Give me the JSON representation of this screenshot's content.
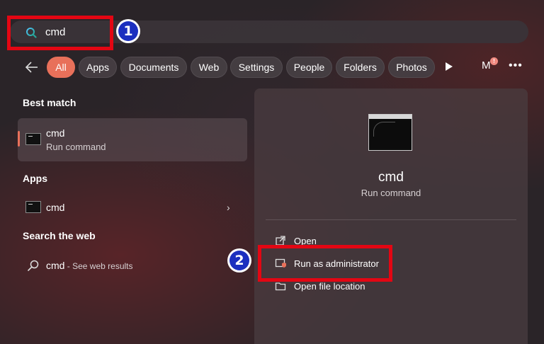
{
  "search": {
    "query": "cmd"
  },
  "annotations": {
    "badge1": "1",
    "badge2": "2"
  },
  "filters": [
    "All",
    "Apps",
    "Documents",
    "Web",
    "Settings",
    "People",
    "Folders",
    "Photos"
  ],
  "avatar": {
    "initial": "M",
    "notification": "!"
  },
  "left": {
    "best_match_heading": "Best match",
    "best_match": {
      "title": "cmd",
      "subtitle": "Run command"
    },
    "apps_heading": "Apps",
    "apps_item": "cmd",
    "web_heading": "Search the web",
    "web_item": {
      "title": "cmd",
      "suffix": " - See web results"
    }
  },
  "right": {
    "title": "cmd",
    "subtitle": "Run command",
    "actions": [
      "Open",
      "Run as administrator",
      "Open file location"
    ]
  },
  "colors": {
    "accent": "#e8705a",
    "annotation_red": "#e30613",
    "annotation_blue": "#1b2fbf"
  },
  "icons": [
    "search-icon",
    "back-arrow-icon",
    "play-icon",
    "more-icon",
    "cmd-icon",
    "chevron-right-icon",
    "open-icon",
    "shield-icon",
    "folder-icon"
  ]
}
